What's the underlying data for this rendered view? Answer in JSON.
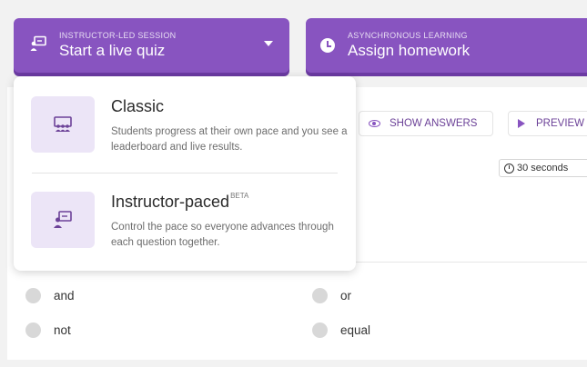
{
  "live_quiz_button": {
    "kicker": "INSTRUCTOR-LED SESSION",
    "title": "Start a live quiz",
    "icon": "presenter-icon"
  },
  "homework_button": {
    "kicker": "ASYNCHRONOUS LEARNING",
    "title": "Assign homework",
    "icon": "clock-icon"
  },
  "toolbar": {
    "show_answers": "SHOW ANSWERS",
    "preview": "PREVIEW"
  },
  "question": {
    "timer": "30 seconds"
  },
  "options": [
    "and",
    "or",
    "not",
    "equal"
  ],
  "dropdown": {
    "items": [
      {
        "title": "Classic",
        "badge": "",
        "description": "Students progress at their own pace and you see a leaderboard and live results.",
        "icon": "group-icon"
      },
      {
        "title": "Instructor-paced",
        "badge": "BETA",
        "description": "Control the pace so everyone advances through each question together.",
        "icon": "presenter-icon"
      }
    ]
  },
  "colors": {
    "brand": "#8854c0",
    "icon_bg": "#ece5f7"
  }
}
